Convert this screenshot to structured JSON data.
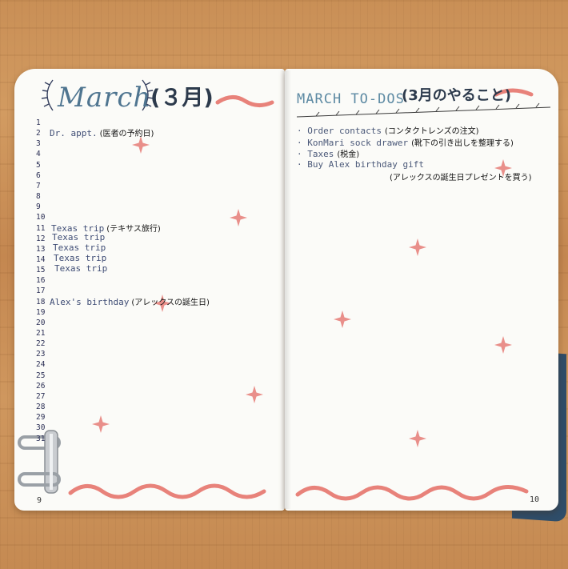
{
  "left_page": {
    "title_script": "March",
    "title_jp": "(３月)",
    "day_numbers": [
      "1",
      "2",
      "3",
      "4",
      "5",
      "6",
      "7",
      "8",
      "9",
      "10",
      "11",
      "12",
      "13",
      "14",
      "15",
      "16",
      "17",
      "18",
      "19",
      "20",
      "21",
      "22",
      "23",
      "24",
      "25",
      "26",
      "27",
      "28",
      "29",
      "30",
      "31"
    ],
    "entries": [
      {
        "day": "2",
        "text": "Dr. appt.",
        "jp": "(医者の予約日)"
      },
      {
        "day": "11",
        "text": "Texas trip",
        "jp": "(テキサス旅行)"
      },
      {
        "day": "12",
        "text": "Texas trip",
        "jp": ""
      },
      {
        "day": "13",
        "text": "Texas trip",
        "jp": ""
      },
      {
        "day": "14",
        "text": "Texas trip",
        "jp": ""
      },
      {
        "day": "15",
        "text": "Texas trip",
        "jp": ""
      },
      {
        "day": "18",
        "text": "Alex's birthday",
        "jp": "(アレックスの誕生日)"
      }
    ],
    "page_number": "9"
  },
  "right_page": {
    "title": "MARCH TO-DOS",
    "title_jp": "(3月のやること)",
    "todos": [
      {
        "text": "· Order contacts",
        "jp": "(コンタクトレンズの注文)"
      },
      {
        "text": "· KonMari sock drawer",
        "jp": "(靴下の引き出しを整理する)"
      },
      {
        "text": "· Taxes",
        "jp": "(税金)"
      },
      {
        "text": "· Buy Alex birthday gift",
        "jp": ""
      }
    ],
    "todo_extra_jp": "(アレックスの誕生日プレゼントを買う)",
    "page_number": "10"
  },
  "colors": {
    "accent_wave": "#e8827a",
    "sparkle": "#e98f8a",
    "title_blue": "#4f7590",
    "ink": "#2b2f55"
  }
}
